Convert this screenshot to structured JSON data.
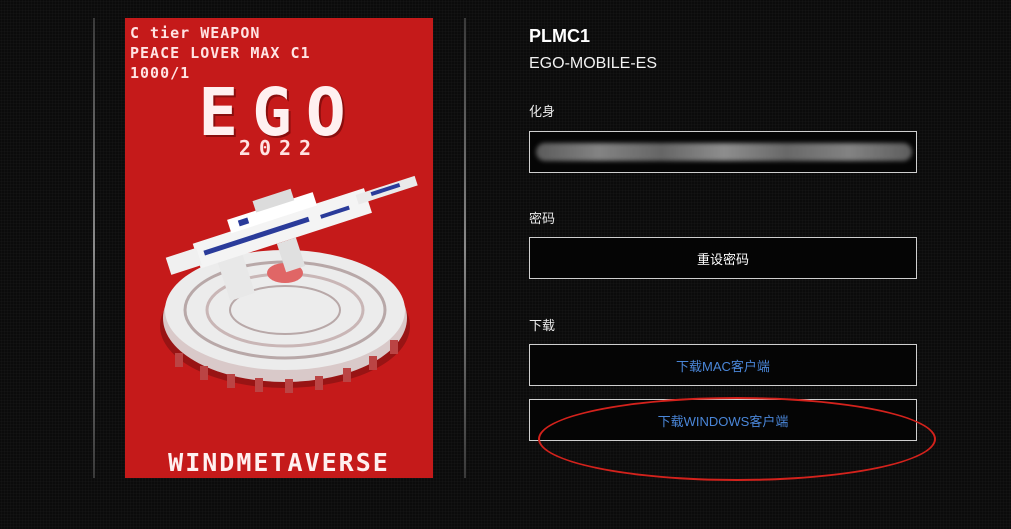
{
  "card": {
    "tier_line": "C tier WEAPON",
    "name_line": "PEACE LOVER MAX C1",
    "edition_line": "1000/1",
    "logo_text": "EGO",
    "year": "2022",
    "brand": "WINDMETAVERSE",
    "accent": "#c51a1a"
  },
  "profile": {
    "username": "PLMC1",
    "game_id": "EGO-MOBILE-ES"
  },
  "avatar_section": {
    "label": "化身"
  },
  "password_section": {
    "label": "密码",
    "reset_button": "重设密码"
  },
  "download_section": {
    "label": "下载",
    "mac_button": "下载MAC客户端",
    "windows_button": "下载WINDOWS客户端",
    "link_color": "#4a86d8"
  },
  "annotation": {
    "highlight_color": "#d4221c"
  }
}
